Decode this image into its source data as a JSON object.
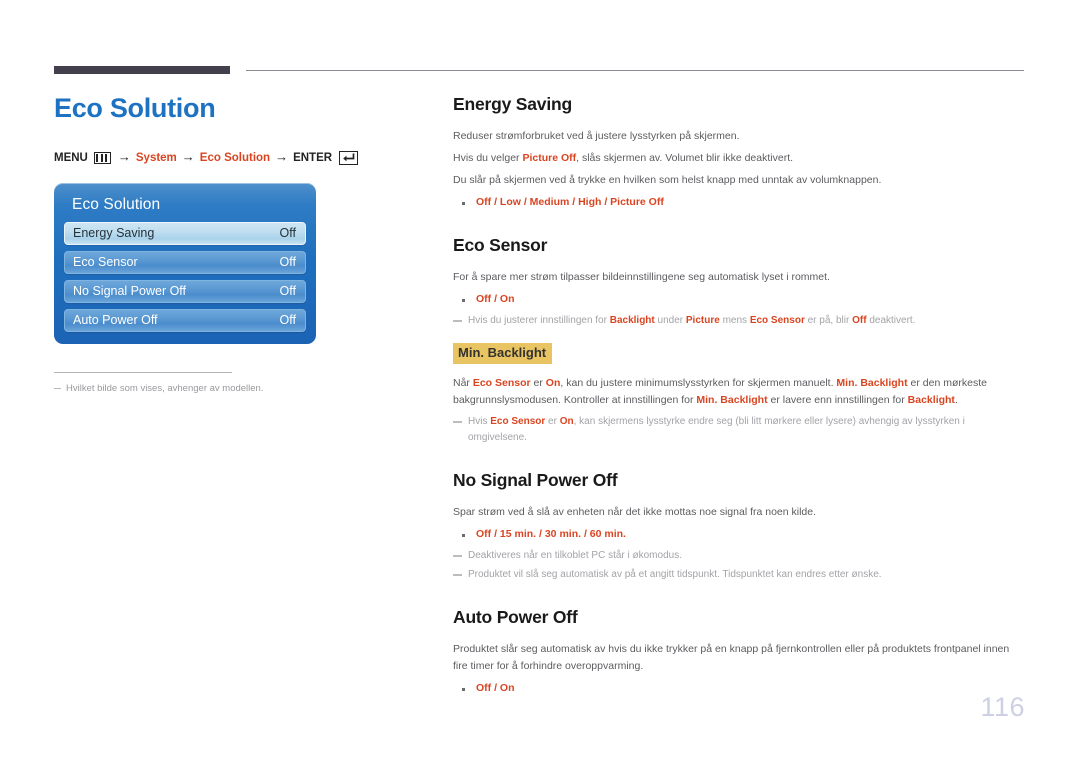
{
  "header": {
    "rule": "decorative-rule"
  },
  "left": {
    "page_title": "Eco Solution",
    "breadcrumb": {
      "menu_label": "MENU",
      "menu_icon": "menu-bars-icon",
      "arrow": "→",
      "step1": "System",
      "step2": "Eco Solution",
      "enter_label": "ENTER",
      "enter_icon": "enter-return-icon"
    },
    "osd": {
      "title": "Eco Solution",
      "rows": [
        {
          "label": "Energy Saving",
          "value": "Off",
          "selected": true
        },
        {
          "label": "Eco Sensor",
          "value": "Off",
          "selected": false
        },
        {
          "label": "No Signal Power Off",
          "value": "Off",
          "selected": false
        },
        {
          "label": "Auto Power Off",
          "value": "Off",
          "selected": false
        }
      ]
    },
    "footnote": "Hvilket bilde som vises, avhenger av modellen."
  },
  "right": {
    "energy_saving": {
      "title": "Energy Saving",
      "p1": "Reduser strømforbruket ved å justere lysstyrken på skjermen.",
      "p2_a": "Hvis du velger ",
      "p2_b": "Picture Off",
      "p2_c": ", slås skjermen av. Volumet blir ikke deaktivert.",
      "p3": "Du slår på skjermen ved å trykke en hvilken som helst knapp med unntak av volumknappen.",
      "options": "Off / Low / Medium / High / Picture Off"
    },
    "eco_sensor": {
      "title": "Eco Sensor",
      "p1": "For å spare mer strøm tilpasser bildeinnstillingene seg automatisk lyset i rommet.",
      "options": "Off / On",
      "note1_a": "Hvis du justerer innstillingen for ",
      "note1_b": "Backlight",
      "note1_c": " under ",
      "note1_d": "Picture",
      "note1_e": " mens ",
      "note1_f": "Eco Sensor",
      "note1_g": " er på, blir ",
      "note1_h": "Off",
      "note1_i": " deaktivert.",
      "subhead": "Min. Backlight",
      "p2_a": "Når ",
      "p2_b": "Eco Sensor",
      "p2_c": " er ",
      "p2_d": "On",
      "p2_e": ", kan du justere minimumslysstyrken for skjermen manuelt. ",
      "p2_f": "Min. Backlight",
      "p2_g": " er den mørkeste bakgrunnslysmodusen. Kontroller at innstillingen for ",
      "p2_h": "Min. Backlight",
      "p2_i": " er lavere enn innstillingen for ",
      "p2_j": "Backlight",
      "p2_k": ".",
      "note2_a": "Hvis ",
      "note2_b": "Eco Sensor",
      "note2_c": " er ",
      "note2_d": "On",
      "note2_e": ", kan skjermens lysstyrke endre seg (bli litt mørkere eller lysere) avhengig av lysstyrken i omgivelsene."
    },
    "no_signal_power_off": {
      "title": "No Signal Power Off",
      "p1": "Spar strøm ved å slå av enheten når det ikke mottas noe signal fra noen kilde.",
      "options": "Off / 15 min. / 30 min. / 60 min.",
      "note1": "Deaktiveres når en tilkoblet PC står i økomodus.",
      "note2": "Produktet vil slå seg automatisk av på et angitt tidspunkt. Tidspunktet kan endres etter ønske."
    },
    "auto_power_off": {
      "title": "Auto Power Off",
      "p1": "Produktet slår seg automatisk av hvis du ikke trykker på en knapp på fjernkontrollen eller på produktets frontpanel innen fire timer for å forhindre overoppvarming.",
      "options": "Off / On"
    }
  },
  "page_number": "116",
  "colors": {
    "title_blue": "#1D72C2",
    "accent_red": "#DA4521",
    "highlight_gold": "#E8C462",
    "rule_dark": "#433f4d",
    "page_number": "#CDD0E4"
  }
}
